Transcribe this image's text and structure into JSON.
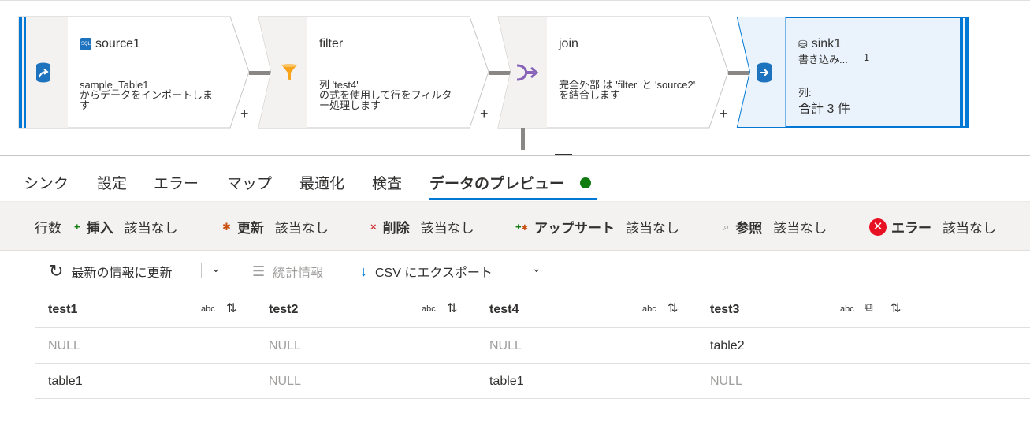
{
  "flow": {
    "nodes": [
      {
        "title": "source1",
        "desc": "sample_Table1\nからデータをインポートしま\nす",
        "icon": "database-source-icon",
        "title_icon": "sql-icon"
      },
      {
        "title": "filter",
        "desc": "列 'test4'\nの式を使用して行をフィルタ\nー処理します",
        "icon": "filter-funnel-icon"
      },
      {
        "title": "join",
        "desc": "完全外部 は 'filter' と 'source2'\nを結合します",
        "icon": "join-icon"
      },
      {
        "title": "sink1",
        "subtitle": "書き込み...",
        "subtitle_count": "1",
        "col_label": "列:",
        "col_value": "合計 3 件",
        "icon": "database-sink-icon",
        "title_icon": "storage-icon",
        "selected": true
      }
    ],
    "plus": "+"
  },
  "tabs": [
    "シンク",
    "設定",
    "エラー",
    "マップ",
    "最適化",
    "検査",
    "データのプレビュー"
  ],
  "active_tab": "データのプレビュー",
  "stats": {
    "label": "行数",
    "items": [
      {
        "label": "挿入",
        "value": "該当なし",
        "glyph": "+",
        "color": "#107c10"
      },
      {
        "label": "更新",
        "value": "該当なし",
        "glyph": "*",
        "color": "#ca5010"
      },
      {
        "label": "削除",
        "value": "該当なし",
        "glyph": "×",
        "color": "#d13438"
      },
      {
        "label": "アップサート",
        "value": "該当なし",
        "glyph": "+*",
        "color": "#107c10"
      },
      {
        "label": "参照",
        "value": "該当なし",
        "glyph": "⌕",
        "color": "#8a8886"
      },
      {
        "label": "エラー",
        "value": "該当なし",
        "glyph": "✕",
        "color": "#d13438"
      }
    ]
  },
  "toolbar": {
    "refresh": "最新の情報に更新",
    "stats": "統計情報",
    "export": "CSV にエクスポート"
  },
  "grid": {
    "columns": [
      {
        "name": "test1",
        "type": "abc"
      },
      {
        "name": "test2",
        "type": "abc"
      },
      {
        "name": "test4",
        "type": "abc"
      },
      {
        "name": "test3",
        "type": "abc"
      }
    ],
    "rows": [
      [
        "NULL",
        "NULL",
        "NULL",
        "table2"
      ],
      [
        "table1",
        "NULL",
        "table1",
        "NULL"
      ]
    ],
    "null_value": "NULL"
  }
}
